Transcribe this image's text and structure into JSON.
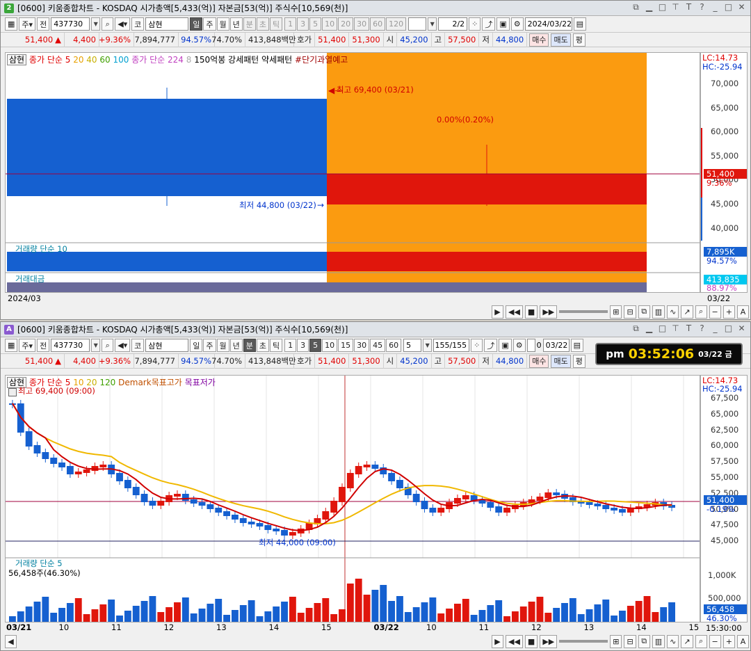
{
  "w1": {
    "badge": "2",
    "title": "[0600] 키움종합차트 - KOSDAQ 시가총액[5,433(억)] 자본금[53(억)] 주식수[10,569(천)]",
    "code": "437730",
    "market": "코",
    "name": "삼현",
    "periods": [
      "일",
      "주",
      "월",
      "년",
      "분",
      "초",
      "틱"
    ],
    "nums": [
      "1",
      "3",
      "5",
      "10",
      "20",
      "30",
      "60",
      "120"
    ],
    "pages": "2/2",
    "date": "2024/03/22",
    "quote": {
      "price": "51,400",
      "chg": "4,400",
      "pct": "+9.36%",
      "vol": "7,894,777",
      "r1": "94.57%",
      "r2": "74.70%",
      "amt": "413,848백만",
      "hoga": "호가",
      "bid1": "51,400",
      "bid2": "51,300",
      "open_l": "시",
      "open": "45,200",
      "high_l": "고",
      "high": "57,500",
      "low_l": "저",
      "low": "44,800",
      "buy": "매수",
      "sell": "매도",
      "avg": "평"
    },
    "legend": {
      "name": "삼현",
      "ma_head": "종가 단순 5",
      "ma20": "20",
      "ma40": "40",
      "ma60": "60",
      "ma100": "100",
      "ma_head2": "종가 단순 224",
      "ma8": "8",
      "pat1": "150억봉 강세패턴",
      "pat2": "약세패턴",
      "warn": "#단기과열예고"
    },
    "hi_label": "최고 69,400 (03/21)",
    "lo_label": "최저 44,800 (03/22)",
    "pct_label": "0.00%(0.20%)",
    "lc": "LC:14.73",
    "hc": "HC:-25.94",
    "yticks": [
      "70,000",
      "65,000",
      "60,000",
      "55,000",
      "50,000",
      "45,000",
      "40,000"
    ],
    "cur": "51,400",
    "curpct": "9.36%",
    "vol_label": "거래량 단순 10",
    "vol_cur": "7,895K",
    "vol_pct": "94.57%",
    "amt_label": "거래대금",
    "amt_cur": "413,835",
    "amt_pct": "88.97%",
    "x_left": "2024/03",
    "x_right": "03/22"
  },
  "w2": {
    "badge": "A",
    "title": "[0600] 키움종합차트 - KOSDAQ 시가총액[5,433(억)] 자본금[53(억)] 주식수[10,569(천)]",
    "code": "437730",
    "market": "코",
    "name": "삼현",
    "periods": [
      "일",
      "주",
      "월",
      "년",
      "분",
      "초",
      "틱"
    ],
    "nums": [
      "1",
      "3",
      "5",
      "10",
      "15",
      "30",
      "45",
      "60"
    ],
    "interval": "5",
    "pages": "155/155",
    "chk": "0",
    "date": "03/22",
    "clock": {
      "ampm": "pm",
      "time": "03:52:06",
      "date": "03/22 금"
    },
    "legend": {
      "name": "삼현",
      "ma_head": "종가 단순 5",
      "ma10": "10",
      "ma20": "20",
      "ma120": "120",
      "demark_hi": "Demark목표고가",
      "demark_lo": "목표저가"
    },
    "hi_label": "최고 69,400 (09:00)",
    "lo_label": "최저 44,000 (09:00)",
    "lc": "LC:14.73",
    "hc": "HC:-25.94",
    "yticks": [
      "67,500",
      "65,000",
      "62,500",
      "60,000",
      "57,500",
      "55,000",
      "52,500",
      "50,000",
      "47,500",
      "45,000"
    ],
    "cur": "51,400",
    "curpct": "-0.19%",
    "vol_label": "거래량 단순 5",
    "vol_sub": "56,458주(46.30%)",
    "vol_ticks": [
      "1,000K",
      "500,000"
    ],
    "vol_cur": "56,458",
    "vol_pct": "46.30%",
    "xlabels": [
      "03/21",
      "10",
      "11",
      "12",
      "13",
      "14",
      "15",
      "03/22",
      "10",
      "11",
      "12",
      "13",
      "14",
      "15"
    ],
    "x_right": "15:30:00"
  }
}
